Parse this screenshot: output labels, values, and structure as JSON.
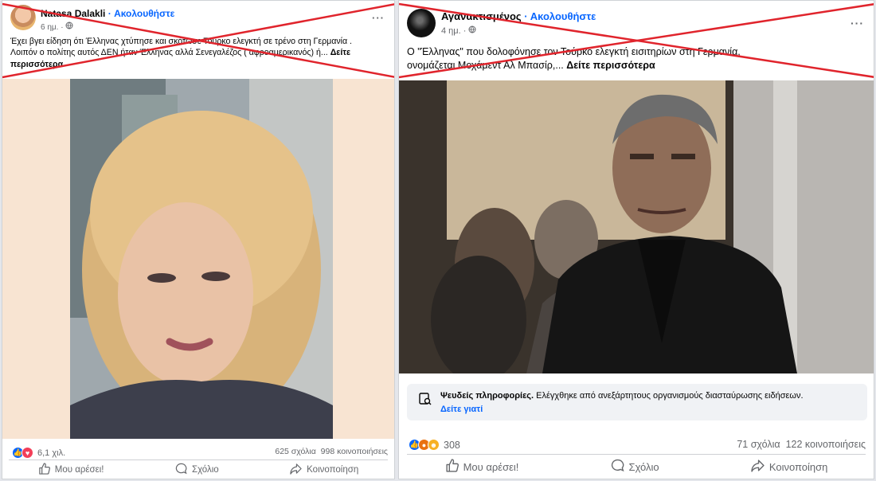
{
  "left_post": {
    "author": "Natasa Dalakli",
    "separator": " · ",
    "follow": "Ακολουθήστε",
    "time": "6 ημ. · ",
    "more": "···",
    "text_line1": "Έχει βγει είδηση ότι Έλληνας χτύπησε και σκότωσε Τούρκο ελεγκτή σε τρένο στη Γερμανία .",
    "text_line2": "Λοιπόν ο πολίτης αυτός ΔΕΝ ήταν Έλληνας αλλά Σενεγαλέζος ( αφροαμερικανός)    ή...",
    "see_more": "Δείτε περισσότερα",
    "reactions_count": "6,1 χιλ.",
    "comments": "625 σχόλια",
    "shares": "998 κοινοποιήσεις",
    "like_label": "Μου αρέσει!",
    "comment_label": "Σχόλιο",
    "share_label": "Κοινοποίηση"
  },
  "right_post": {
    "author": "Αγανακτισμένος",
    "separator": " · ",
    "follow": "Ακολουθήστε",
    "time": "4 ημ. · ",
    "more": "···",
    "text_line1": "Ο \"Έλληνας\" που δολοφόνησε τον Τούρκο ελεγκτή εισιτηρίων στη Γερμανία,",
    "text_line2": "ονομάζεται Μοχάμεντ Αλ Μπασίρ,...",
    "see_more": "Δείτε περισσότερα",
    "fact_title": "Ψευδείς πληροφορίες.",
    "fact_text": " Ελέγχθηκε από ανεξάρτητους οργανισμούς διασταύρωσης ειδήσεων.",
    "fact_link": "Δείτε γιατί",
    "reactions_count": "308",
    "comments": "71 σχόλια",
    "shares": "122 κοινοποιήσεις",
    "like_label": "Μου αρέσει!",
    "comment_label": "Σχόλιο",
    "share_label": "Κοινοποίηση"
  },
  "colors": {
    "facebook_blue": "#0866ff",
    "cross_red": "#e0242c",
    "love_red": "#f33e58",
    "haha_yellow": "#f7b125",
    "angry_orange": "#e9710f"
  },
  "icons": {
    "globe": "globe-icon",
    "like": "thumbs-up-icon",
    "comment": "speech-bubble-icon",
    "share": "share-arrow-icon",
    "fact_check": "fact-check-icon"
  }
}
